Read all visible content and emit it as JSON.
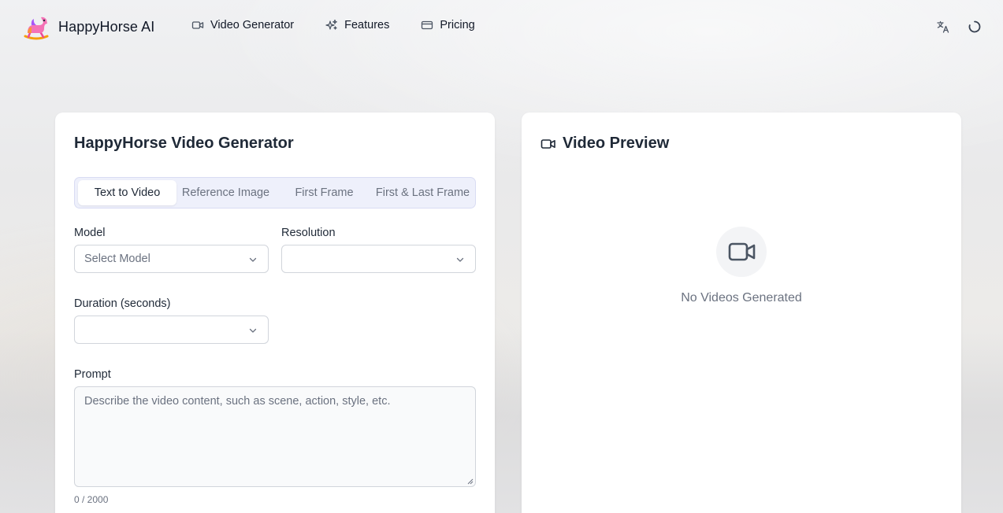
{
  "brand": {
    "name": "HappyHorse AI",
    "logo_icon": "rocking-horse-logo"
  },
  "nav": [
    {
      "label": "Video Generator",
      "icon": "video-camera-icon"
    },
    {
      "label": "Features",
      "icon": "sparkles-icon"
    },
    {
      "label": "Pricing",
      "icon": "credit-card-icon"
    }
  ],
  "header_actions": {
    "language_icon": "translate-icon",
    "loading_icon": "spinner-icon"
  },
  "generator": {
    "title": "HappyHorse Video Generator",
    "tabs": [
      {
        "label": "Text to Video",
        "active": true
      },
      {
        "label": "Reference Image",
        "active": false
      },
      {
        "label": "First Frame",
        "active": false
      },
      {
        "label": "First & Last Frame",
        "active": false
      }
    ],
    "model": {
      "label": "Model",
      "placeholder": "Select Model",
      "value": ""
    },
    "resolution": {
      "label": "Resolution",
      "value": ""
    },
    "duration": {
      "label": "Duration (seconds)",
      "value": ""
    },
    "prompt": {
      "label": "Prompt",
      "placeholder": "Describe the video content, such as scene, action, style, etc.",
      "value": "",
      "counter": "0 / 2000"
    }
  },
  "preview": {
    "title": "Video Preview",
    "empty_text": "No Videos Generated"
  },
  "colors": {
    "tab_bg": "#eef0fb",
    "text_primary": "#1f2937",
    "text_muted": "#6b7280"
  }
}
